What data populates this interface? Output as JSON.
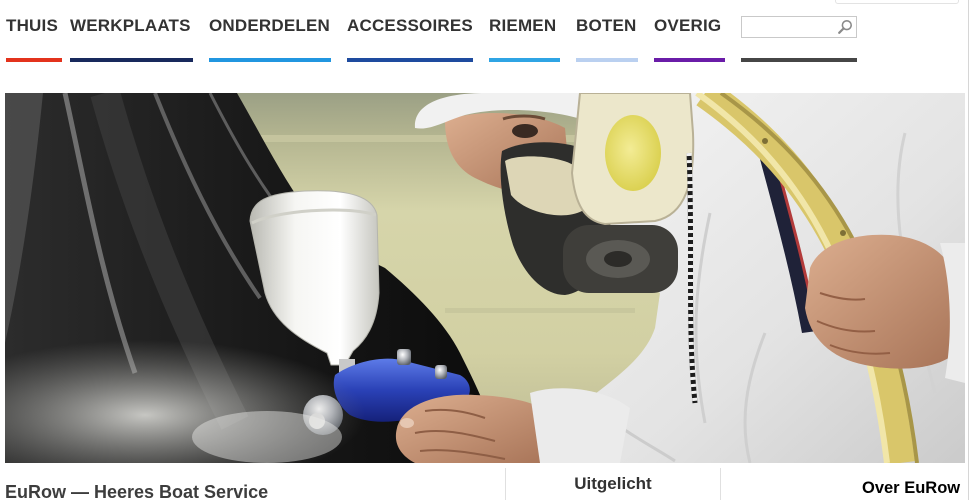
{
  "nav": {
    "items": [
      {
        "label": "THUIS",
        "color": "#e3321c"
      },
      {
        "label": "WERKPLAATS",
        "color": "#18295c"
      },
      {
        "label": "ONDERDELEN",
        "color": "#2196e0"
      },
      {
        "label": "ACCESSOIRES",
        "color": "#1e4b9f"
      },
      {
        "label": "RIEMEN",
        "color": "#2fa4e4"
      },
      {
        "label": "BOTEN",
        "color": "#bad0f0"
      },
      {
        "label": "OVERIG",
        "color": "#6a1ca8"
      }
    ]
  },
  "search": {
    "value": "",
    "icon": "search-icon",
    "color": "#464646"
  },
  "main": {
    "title": "EuRow — Heeres Boat Service"
  },
  "featured": {
    "title": "Uitgelicht"
  },
  "about": {
    "title": "Over EuRow"
  }
}
